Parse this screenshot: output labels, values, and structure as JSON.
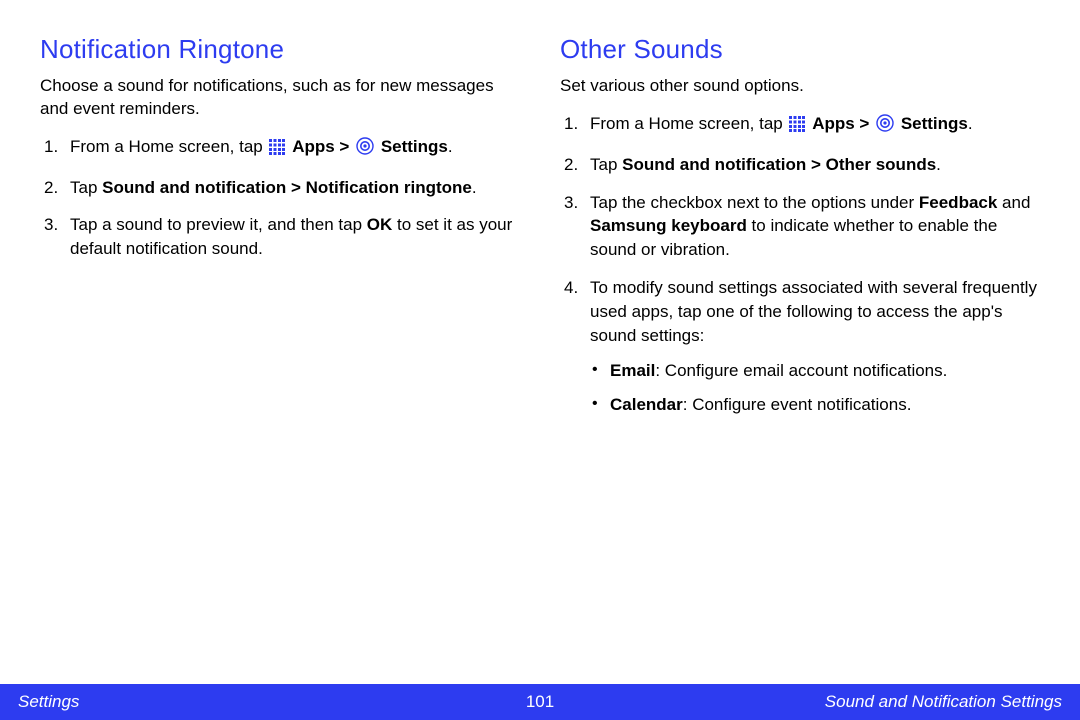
{
  "left": {
    "title": "Notification Ringtone",
    "intro": "Choose a sound for notifications, such as for new messages and event reminders.",
    "step1_pre": "From a Home screen, tap ",
    "step1_apps": "Apps > ",
    "step1_settings": "Settings",
    "step1_post": ".",
    "step2_pre": "Tap ",
    "step2_bold": "Sound and notification > Notification ringtone",
    "step2_post": ".",
    "step3_a": "Tap a sound to preview it, and then tap ",
    "step3_ok": "OK",
    "step3_b": " to set it as your default notification sound."
  },
  "right": {
    "title": "Other Sounds",
    "intro": "Set various other sound options.",
    "step1_pre": "From a Home screen, tap ",
    "step1_apps": "Apps > ",
    "step1_settings": "Settings",
    "step1_post": ".",
    "step2_pre": "Tap ",
    "step2_bold": "Sound and notification > Other sounds",
    "step2_post": ".",
    "step3_a": "Tap the checkbox next to the options under ",
    "step3_fb": "Feedback",
    "step3_and": " and ",
    "step3_sk": "Samsung keyboard",
    "step3_b": " to indicate whether to enable the sound or vibration.",
    "step4": "To modify sound settings associated with several frequently used apps, tap one of the following to access the app's sound settings:",
    "sub1_label": "Email",
    "sub1_text": ": Configure email account notifications.",
    "sub2_label": "Calendar",
    "sub2_text": ": Configure event notifications."
  },
  "footer": {
    "left": "Settings",
    "page": "101",
    "right": "Sound and Notification Settings"
  }
}
